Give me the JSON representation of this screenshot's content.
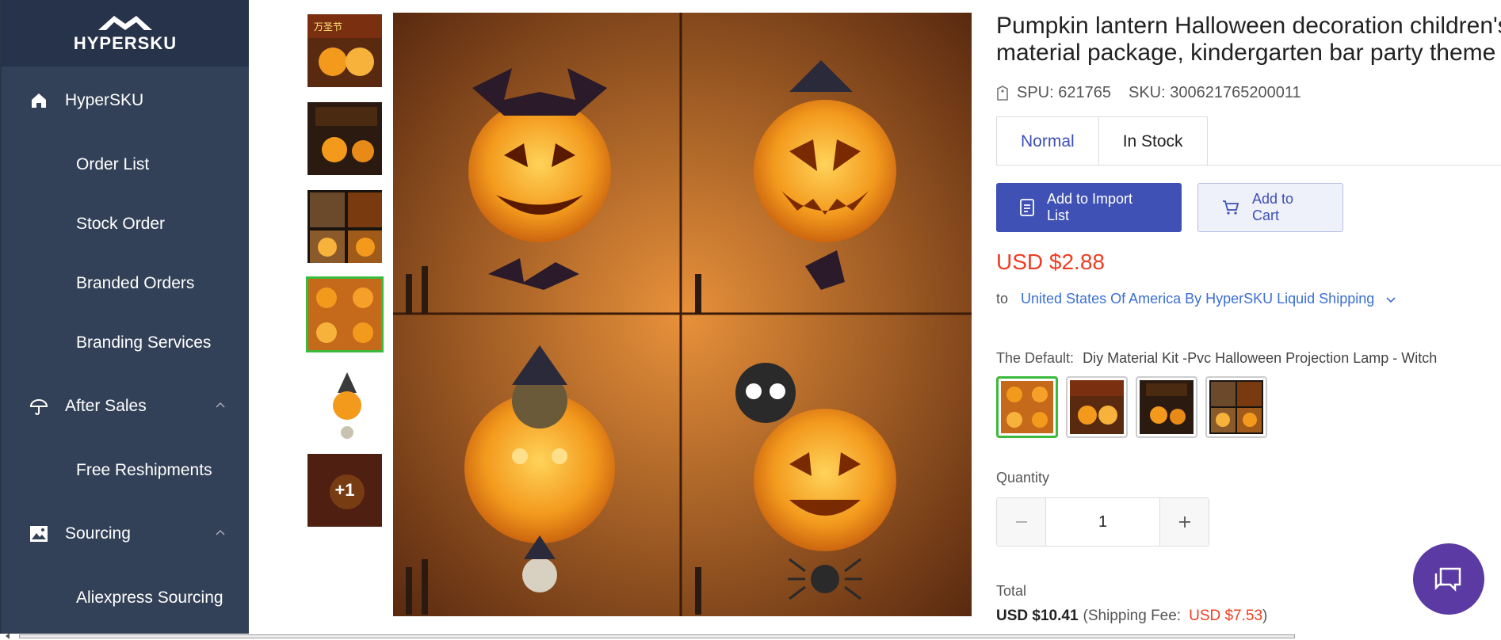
{
  "sidebar": {
    "logo": "HYPERSKU",
    "groups": [
      {
        "label": "HyperSKU",
        "icon": "home-icon"
      },
      {
        "label": "After Sales",
        "icon": "umbrella-icon"
      },
      {
        "label": "Sourcing",
        "icon": "image-icon"
      }
    ],
    "items": {
      "order_list": "Order List",
      "stock_order": "Stock Order",
      "branded_orders": "Branded Orders",
      "branding_services": "Branding Services",
      "free_reshipments": "Free Reshipments",
      "aliexpress_sourcing": "Aliexpress Sourcing"
    }
  },
  "gallery": {
    "more_count": "+1"
  },
  "product": {
    "title_line1": "Pumpkin lantern Halloween decoration children's",
    "title_line2": "material package, kindergarten bar party theme",
    "spu_label": "SPU: 621765",
    "sku_label": "SKU: 300621765200011",
    "tabs": [
      "Normal",
      "In Stock"
    ],
    "add_import_label": "Add to Import List",
    "add_cart_label": "Add to Cart",
    "price": "USD $2.88",
    "ship_to": "to",
    "ship_dest": "United States Of America By HyperSKU Liquid Shipping",
    "variant_label": "The Default:",
    "variant_value": "Diy Material Kit -Pvc Halloween Projection Lamp - Witch",
    "quantity_label": "Quantity",
    "quantity": "1",
    "total_label": "Total",
    "total_amount": "USD $10.41",
    "shipping_fee_label": "(Shipping Fee:",
    "shipping_fee": "USD $7.53",
    "shipping_fee_close": ")"
  },
  "colors": {
    "sidebar_bg": "#334158",
    "accent": "#3f51b5",
    "price": "#ef3d22",
    "link": "#3b6fd4",
    "selected": "#3cba3c",
    "chat": "#5b3aa3"
  }
}
